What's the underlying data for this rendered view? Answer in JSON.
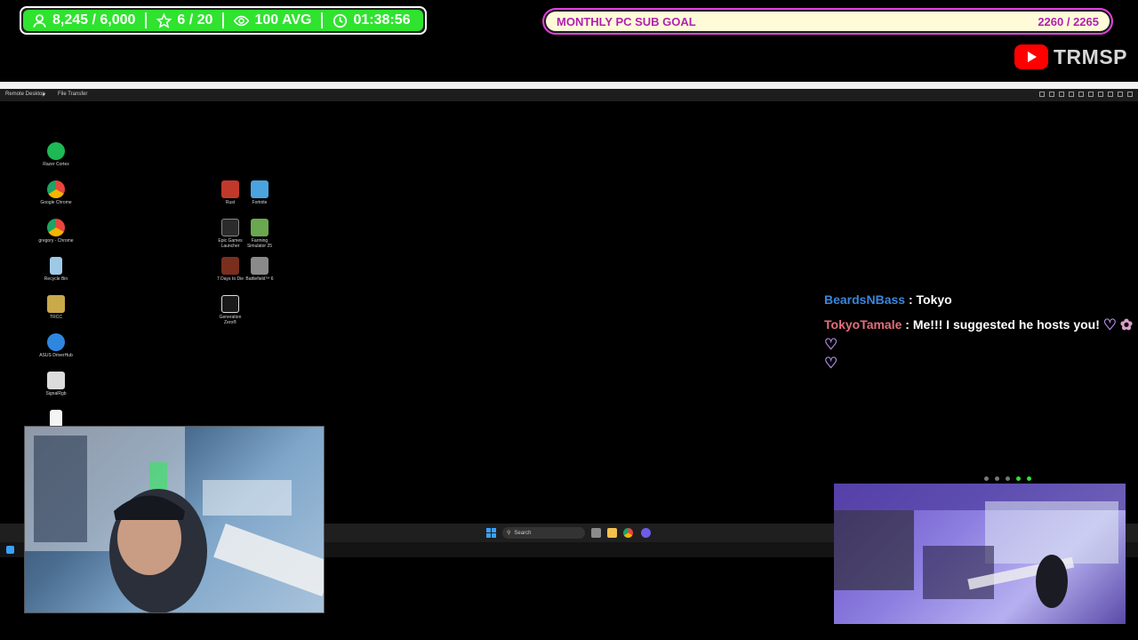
{
  "stats": {
    "followers": "8,245 / 6,000",
    "stars": "6 / 20",
    "viewers": "100 AVG",
    "uptime": "01:38:56"
  },
  "goal": {
    "label": "MONTHLY PC SUB GOAL",
    "value": "2260 / 2265"
  },
  "youtube": {
    "channel": "TRMSP"
  },
  "remote_desktop": {
    "address_bar": "",
    "tabs": [
      "Remote Desktop",
      "File Transfer"
    ]
  },
  "desktop_icons_left": [
    {
      "label": "Razer Cortex",
      "color": "#1db954"
    },
    {
      "label": "Google Chrome",
      "color": "#e8453c"
    },
    {
      "label": "gregory - Chrome",
      "color": "#f4b400"
    },
    {
      "label": "Recycle Bin",
      "color": "#9ec9e6"
    },
    {
      "label": "TRCC",
      "color": "#c9a94a"
    },
    {
      "label": "ASUS DriverHub",
      "color": "#2e86de"
    },
    {
      "label": "SignalRgb",
      "color": "#dcdcdc"
    }
  ],
  "desktop_icons_right": [
    {
      "label": "Rust",
      "color": "#c0392b"
    },
    {
      "label": "Fortnite",
      "color": "#4aa3df"
    },
    {
      "label": "Epic Games Launcher",
      "color": "#2b2b2b"
    },
    {
      "label": "Farming Simulator 25",
      "color": "#6aa84f"
    },
    {
      "label": "7 Days to Die",
      "color": "#7a2e1e"
    },
    {
      "label": "Battlefield™ 6",
      "color": "#8a8a8a"
    },
    {
      "label": "Generation Zero®",
      "color": "#1a1a1a"
    }
  ],
  "chat": [
    {
      "user": "BeardsNBass",
      "sep": " : ",
      "text": "Tokyo"
    },
    {
      "user": "TokyoTamale",
      "sep": " : ",
      "text": "Me!!! I suggested he hosts you!"
    }
  ],
  "taskbar": {
    "search_label": "Search"
  }
}
